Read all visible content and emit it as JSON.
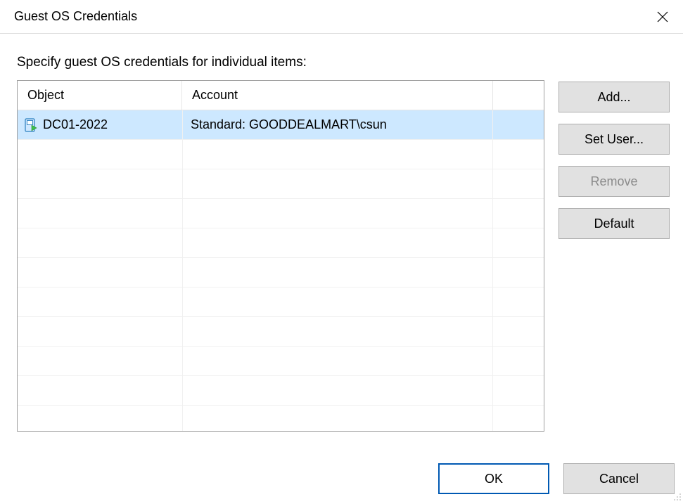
{
  "title": "Guest OS Credentials",
  "instruction": "Specify guest OS credentials for individual items:",
  "columns": {
    "object": "Object",
    "account": "Account"
  },
  "rows": [
    {
      "object": "DC01-2022",
      "account": "Standard: GOODDEALMART\\csun",
      "selected": true,
      "icon": "vm-icon"
    }
  ],
  "sideButtons": {
    "add": "Add...",
    "setUser": "Set User...",
    "remove": "Remove",
    "default": "Default"
  },
  "footer": {
    "ok": "OK",
    "cancel": "Cancel"
  }
}
